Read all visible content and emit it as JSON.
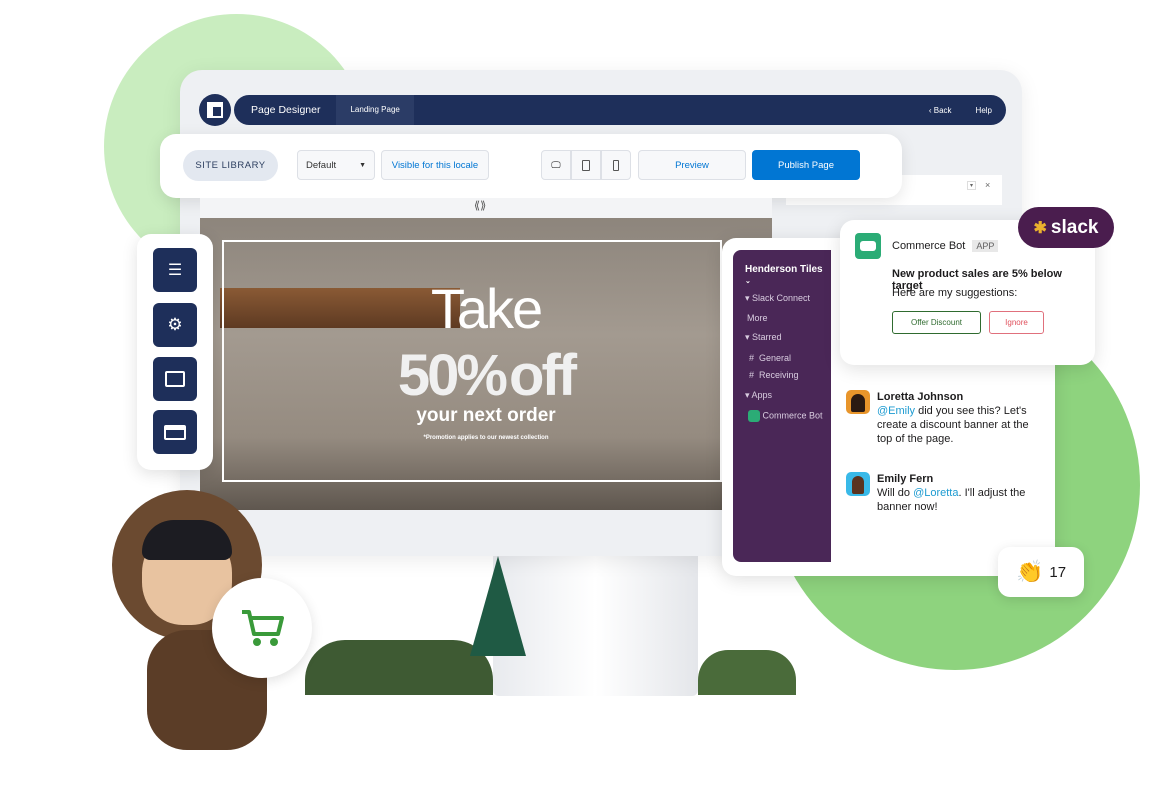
{
  "topbar": {
    "app_title": "Page Designer",
    "tab": "Landing Page",
    "back": "Back",
    "help": "Help"
  },
  "toolbar": {
    "site_library": "SITE LIBRARY",
    "select_value": "Default",
    "visibility": "Visible for this locale",
    "preview": "Preview",
    "publish": "Publish Page"
  },
  "banner": {
    "line1": "Take",
    "line2_num": "50%",
    "line2_word": "off",
    "line3": "your next order",
    "note": "*Promotion applies to our newest collection"
  },
  "tools": [
    "list-icon",
    "gear-icon",
    "folder-wrench-icon",
    "credit-card-icon"
  ],
  "slack": {
    "workspace": "Henderson Tiles",
    "sections": {
      "connect": "Slack Connect",
      "more": "More",
      "starred": "Starred",
      "general": "General",
      "receiving": "Receiving",
      "apps": "Apps",
      "bot": "Commerce Bot"
    },
    "bot_card": {
      "name": "Commerce Bot",
      "badge": "APP",
      "headline": "New product sales are 5% below target",
      "sub": "Here are my suggestions:",
      "offer": "Offer Discount",
      "ignore": "Ignore"
    },
    "messages": [
      {
        "author": "Loretta Johnson",
        "mention": "@Emily",
        "text": " did you see this? Let's create a discount banner at the top of the page."
      },
      {
        "author": "Emily Fern",
        "pre": "Will do ",
        "mention": "@Loretta",
        "text": ". I'll adjust the banner now!"
      }
    ],
    "logo": "slack",
    "reaction_count": "17"
  },
  "colors": {
    "navy": "#1e2f5a",
    "publish": "#0176d3",
    "slack_purple": "#4a2757",
    "green": "#8ed37e",
    "bot_green": "#2bac76"
  }
}
